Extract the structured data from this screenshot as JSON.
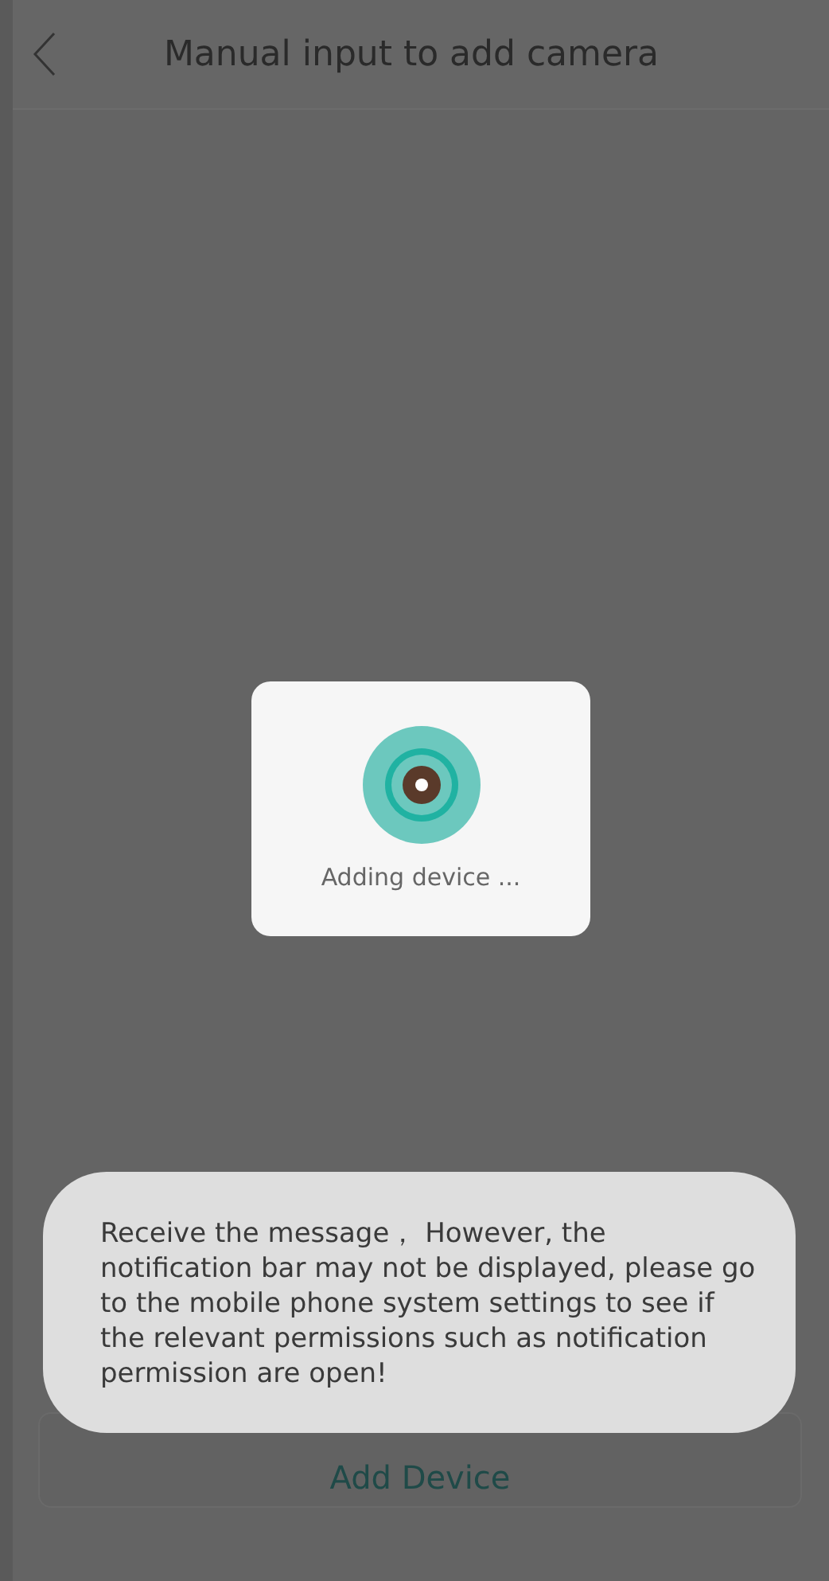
{
  "header": {
    "title": "Manual input to add camera"
  },
  "dialog": {
    "message": "Adding device ..."
  },
  "add_button": {
    "label": "Add Device"
  },
  "toast": {
    "message": "Receive the message， However, the notification bar may not be displayed, please go to the mobile phone system settings to see if the relevant permissions such as notification permission are open!"
  }
}
